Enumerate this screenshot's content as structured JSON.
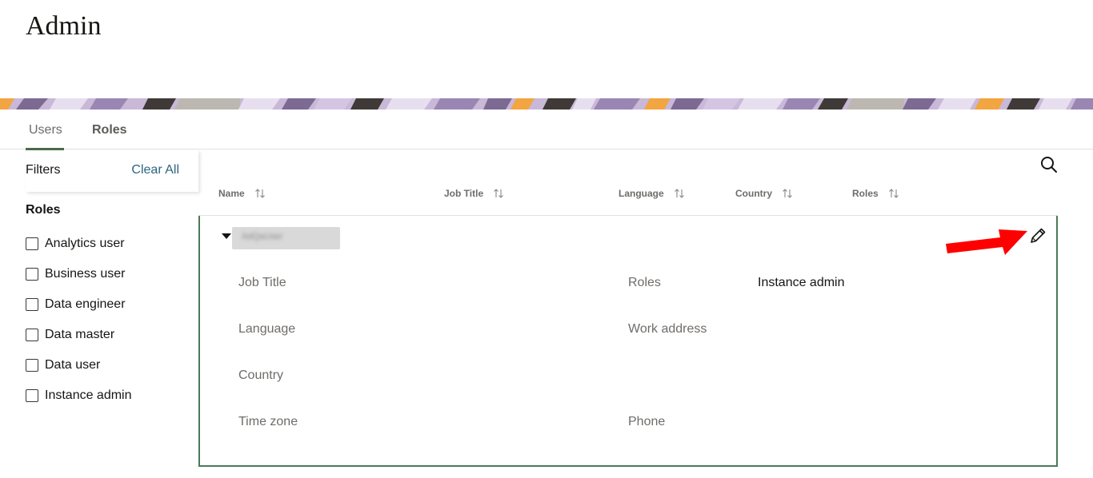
{
  "page": {
    "title": "Admin"
  },
  "tabs": [
    {
      "label": "Users",
      "active": true
    },
    {
      "label": "Roles",
      "active": false
    }
  ],
  "filters": {
    "label": "Filters",
    "clear_all": "Clear All",
    "roles_heading": "Roles",
    "roles": [
      {
        "label": "Analytics user",
        "checked": false
      },
      {
        "label": "Business user",
        "checked": false
      },
      {
        "label": "Data engineer",
        "checked": false
      },
      {
        "label": "Data master",
        "checked": false
      },
      {
        "label": "Data user",
        "checked": false
      },
      {
        "label": "Instance admin",
        "checked": false
      }
    ]
  },
  "table": {
    "columns": [
      "Name",
      "Job Title",
      "Language",
      "Country",
      "Roles"
    ],
    "expanded_row": {
      "name_redacted": "AdQaUser",
      "fields": {
        "job_title_label": "Job Title",
        "language_label": "Language",
        "country_label": "Country",
        "time_zone_label": "Time zone",
        "roles_label": "Roles",
        "roles_value": "Instance admin",
        "work_address_label": "Work address",
        "phone_label": "Phone"
      }
    }
  },
  "icons": {
    "search": "search-icon",
    "sort": "sort-icon",
    "edit": "pencil-icon",
    "expand": "caret-down-icon",
    "annotation": "red-arrow-icon"
  },
  "colors": {
    "accent_green": "#4a7a5a",
    "link_blue": "#2b6680",
    "annotation_red": "#ff0000"
  }
}
